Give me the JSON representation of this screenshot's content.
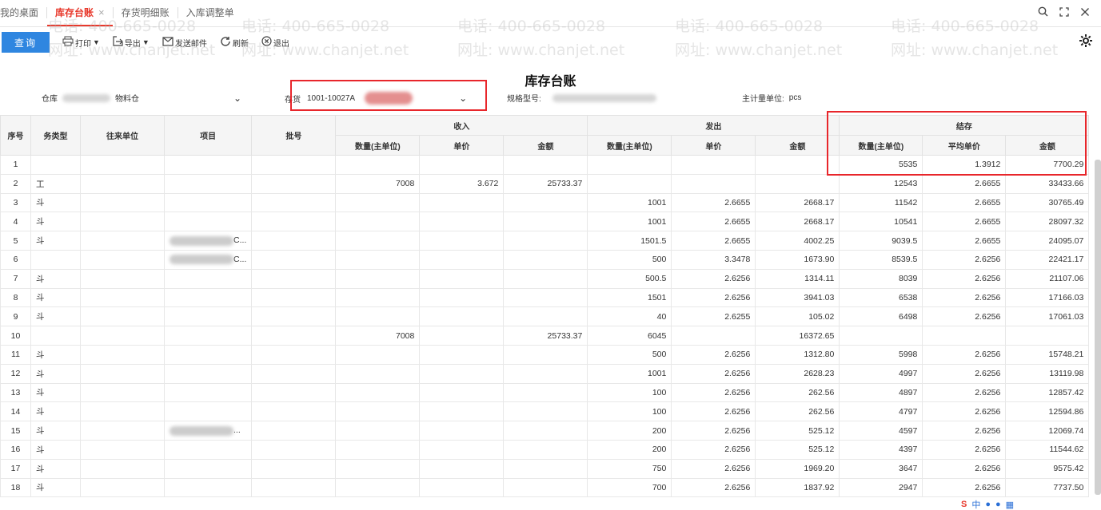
{
  "tabs": [
    {
      "label": "我的桌面",
      "active": false
    },
    {
      "label": "库存台账",
      "active": true,
      "close": "×"
    },
    {
      "label": "存货明细账",
      "active": false
    },
    {
      "label": "入库调整单",
      "active": false
    }
  ],
  "window_controls": {
    "search": "🔍",
    "maximize": "⛶",
    "close": "✕"
  },
  "toolbar": {
    "query": "查询",
    "print": "打印",
    "export": "导出",
    "send": "发送邮件",
    "refresh": "刷新",
    "exit": "退出"
  },
  "report_title": "库存台账",
  "filters": {
    "warehouse_label": "仓库",
    "warehouse_value": "物料仓",
    "inventory_label": "存货",
    "inventory_value": "1001-10027A",
    "spec_label": "规格型号:",
    "unit_label": "主计量单位:",
    "unit_value": "pcs"
  },
  "watermark": {
    "phone": "电话: 400-665-0028",
    "site": "网址: www.chanjet.net"
  },
  "columns": {
    "seq": "序号",
    "biz_type": "务类型",
    "partner": "往来单位",
    "project": "项目",
    "batch": "批号",
    "in_group": "收入",
    "out_group": "发出",
    "bal_group": "结存",
    "qty": "数量(主单位)",
    "price": "单价",
    "amount": "金额",
    "avg_price": "平均单价"
  },
  "rows": [
    {
      "seq": "1",
      "type": "",
      "partner": "",
      "project": "",
      "in_qty": "",
      "in_price": "",
      "in_amt": "",
      "out_qty": "",
      "out_price": "",
      "out_amt": "",
      "bal_qty": "5535",
      "bal_price": "1.3912",
      "bal_amt": "7700.29"
    },
    {
      "seq": "2",
      "type": "工",
      "partner": "",
      "project": "",
      "in_qty": "7008",
      "in_price": "3.672",
      "in_amt": "25733.37",
      "out_qty": "",
      "out_price": "",
      "out_amt": "",
      "bal_qty": "12543",
      "bal_price": "2.6655",
      "bal_amt": "33433.66"
    },
    {
      "seq": "3",
      "type": "斗",
      "partner": "",
      "project": "",
      "in_qty": "",
      "in_price": "",
      "in_amt": "",
      "out_qty": "1001",
      "out_price": "2.6655",
      "out_amt": "2668.17",
      "bal_qty": "11542",
      "bal_price": "2.6655",
      "bal_amt": "30765.49"
    },
    {
      "seq": "4",
      "type": "斗",
      "partner": "",
      "project": "",
      "in_qty": "",
      "in_price": "",
      "in_amt": "",
      "out_qty": "1001",
      "out_price": "2.6655",
      "out_amt": "2668.17",
      "bal_qty": "10541",
      "bal_price": "2.6655",
      "bal_amt": "28097.32"
    },
    {
      "seq": "5",
      "type": "斗",
      "partner": "",
      "project": "C...",
      "in_qty": "",
      "in_price": "",
      "in_amt": "",
      "out_qty": "1501.5",
      "out_price": "2.6655",
      "out_amt": "4002.25",
      "bal_qty": "9039.5",
      "bal_price": "2.6655",
      "bal_amt": "24095.07"
    },
    {
      "seq": "6",
      "type": "",
      "partner": "",
      "project": "C...",
      "in_qty": "",
      "in_price": "",
      "in_amt": "",
      "out_qty": "500",
      "out_price": "3.3478",
      "out_amt": "1673.90",
      "bal_qty": "8539.5",
      "bal_price": "2.6256",
      "bal_amt": "22421.17"
    },
    {
      "seq": "7",
      "type": "斗",
      "partner": "",
      "project": "",
      "in_qty": "",
      "in_price": "",
      "in_amt": "",
      "out_qty": "500.5",
      "out_price": "2.6256",
      "out_amt": "1314.11",
      "bal_qty": "8039",
      "bal_price": "2.6256",
      "bal_amt": "21107.06"
    },
    {
      "seq": "8",
      "type": "斗",
      "partner": "",
      "project": "",
      "in_qty": "",
      "in_price": "",
      "in_amt": "",
      "out_qty": "1501",
      "out_price": "2.6256",
      "out_amt": "3941.03",
      "bal_qty": "6538",
      "bal_price": "2.6256",
      "bal_amt": "17166.03"
    },
    {
      "seq": "9",
      "type": "斗",
      "partner": "",
      "project": "",
      "in_qty": "",
      "in_price": "",
      "in_amt": "",
      "out_qty": "40",
      "out_price": "2.6255",
      "out_amt": "105.02",
      "bal_qty": "6498",
      "bal_price": "2.6256",
      "bal_amt": "17061.03"
    },
    {
      "seq": "10",
      "type": "",
      "partner": "",
      "project": "",
      "in_qty": "7008",
      "in_price": "",
      "in_amt": "25733.37",
      "out_qty": "6045",
      "out_price": "",
      "out_amt": "16372.65",
      "bal_qty": "",
      "bal_price": "",
      "bal_amt": ""
    },
    {
      "seq": "11",
      "type": "斗",
      "partner": "",
      "project": "",
      "in_qty": "",
      "in_price": "",
      "in_amt": "",
      "out_qty": "500",
      "out_price": "2.6256",
      "out_amt": "1312.80",
      "bal_qty": "5998",
      "bal_price": "2.6256",
      "bal_amt": "15748.21"
    },
    {
      "seq": "12",
      "type": "斗",
      "partner": "",
      "project": "",
      "in_qty": "",
      "in_price": "",
      "in_amt": "",
      "out_qty": "1001",
      "out_price": "2.6256",
      "out_amt": "2628.23",
      "bal_qty": "4997",
      "bal_price": "2.6256",
      "bal_amt": "13119.98"
    },
    {
      "seq": "13",
      "type": "斗",
      "partner": "",
      "project": "",
      "in_qty": "",
      "in_price": "",
      "in_amt": "",
      "out_qty": "100",
      "out_price": "2.6256",
      "out_amt": "262.56",
      "bal_qty": "4897",
      "bal_price": "2.6256",
      "bal_amt": "12857.42"
    },
    {
      "seq": "14",
      "type": "斗",
      "partner": "",
      "project": "",
      "in_qty": "",
      "in_price": "",
      "in_amt": "",
      "out_qty": "100",
      "out_price": "2.6256",
      "out_amt": "262.56",
      "bal_qty": "4797",
      "bal_price": "2.6256",
      "bal_amt": "12594.86"
    },
    {
      "seq": "15",
      "type": "斗",
      "partner": "",
      "project": "...",
      "in_qty": "",
      "in_price": "",
      "in_amt": "",
      "out_qty": "200",
      "out_price": "2.6256",
      "out_amt": "525.12",
      "bal_qty": "4597",
      "bal_price": "2.6256",
      "bal_amt": "12069.74"
    },
    {
      "seq": "16",
      "type": "斗",
      "partner": "",
      "project": "",
      "in_qty": "",
      "in_price": "",
      "in_amt": "",
      "out_qty": "200",
      "out_price": "2.6256",
      "out_amt": "525.12",
      "bal_qty": "4397",
      "bal_price": "2.6256",
      "bal_amt": "11544.62"
    },
    {
      "seq": "17",
      "type": "斗",
      "partner": "",
      "project": "",
      "in_qty": "",
      "in_price": "",
      "in_amt": "",
      "out_qty": "750",
      "out_price": "2.6256",
      "out_amt": "1969.20",
      "bal_qty": "3647",
      "bal_price": "2.6256",
      "bal_amt": "9575.42"
    },
    {
      "seq": "18",
      "type": "斗",
      "partner": "",
      "project": "",
      "in_qty": "",
      "in_price": "",
      "in_amt": "",
      "out_qty": "700",
      "out_price": "2.6256",
      "out_amt": "1837.92",
      "bal_qty": "2947",
      "bal_price": "2.6256",
      "bal_amt": "7737.50"
    }
  ],
  "tray": {
    "ime": "S",
    "lang": "中"
  }
}
